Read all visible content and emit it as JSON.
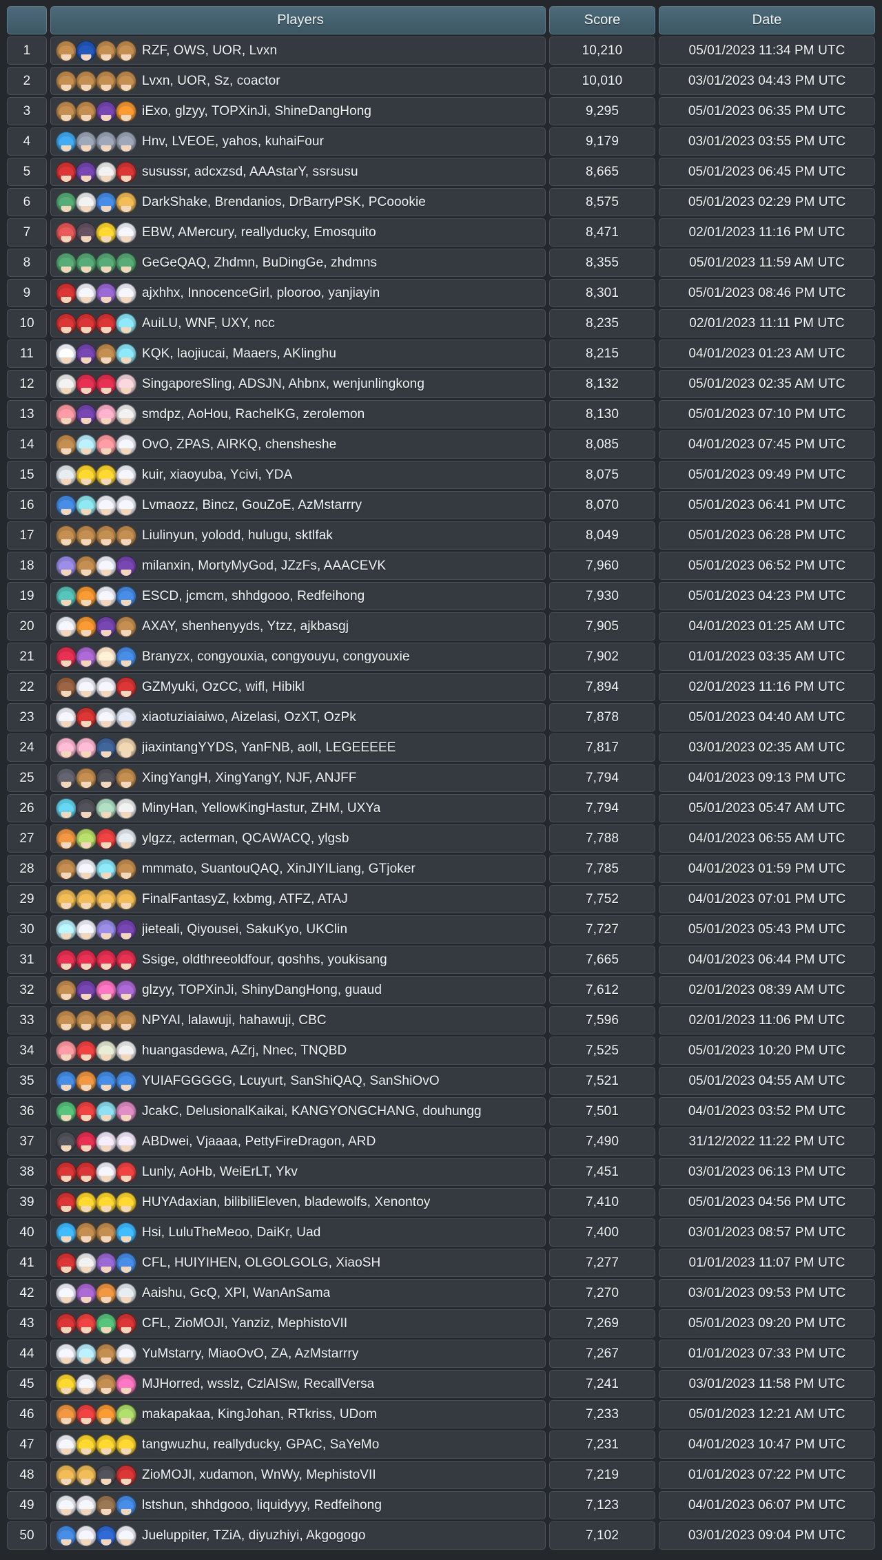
{
  "table": {
    "columns": [
      {
        "key": "rank",
        "label": ""
      },
      {
        "key": "players",
        "label": "Players"
      },
      {
        "key": "score",
        "label": "Score"
      },
      {
        "key": "date",
        "label": "Date"
      }
    ],
    "header_bg": "#44616f",
    "cell_bg": "#343a40",
    "page_bg": "#24272b",
    "text_color": "#f2f4f6"
  },
  "rows": [
    {
      "rank": "1",
      "players": "RZF, OWS, UOR, Lvxn",
      "score": "10,210",
      "date": "05/01/2023 11:34 PM UTC",
      "avatars": [
        "#b08048",
        "#1f4fa8",
        "#b08048",
        "#b08048"
      ]
    },
    {
      "rank": "2",
      "players": "Lvxn, UOR, Sz, coactor",
      "score": "10,010",
      "date": "03/01/2023 04:43 PM UTC",
      "avatars": [
        "#b08048",
        "#b08048",
        "#b08048",
        "#b08048"
      ]
    },
    {
      "rank": "3",
      "players": "iExo, glzyy, TOPXinJi, ShineDangHong",
      "score": "9,295",
      "date": "05/01/2023 06:35 PM UTC",
      "avatars": [
        "#b08048",
        "#b08048",
        "#6b3fa0",
        "#e08a2e"
      ]
    },
    {
      "rank": "4",
      "players": "Hnv, LVEOE, yahos, kuhaiFour",
      "score": "9,179",
      "date": "03/01/2023 03:55 PM UTC",
      "avatars": [
        "#3a9ad9",
        "#8d96a6",
        "#8d96a6",
        "#8d96a6"
      ]
    },
    {
      "rank": "5",
      "players": "susussr, adcxzsd, AAAstarY, ssrsusu",
      "score": "8,665",
      "date": "05/01/2023 06:45 PM UTC",
      "avatars": [
        "#c43030",
        "#6b3fa0",
        "#d8d8d8",
        "#c43030"
      ]
    },
    {
      "rank": "6",
      "players": "DarkShake, Brendanios, DrBarryPSK, PCoookie",
      "score": "8,575",
      "date": "05/01/2023 02:29 PM UTC",
      "avatars": [
        "#4f9a6a",
        "#d8d8d8",
        "#3f7fd0",
        "#d8a94e"
      ]
    },
    {
      "rank": "7",
      "players": "EBW, AMercury, reallyducky, Emosquito",
      "score": "8,471",
      "date": "02/01/2023 11:16 PM UTC",
      "avatars": [
        "#d05050",
        "#5a4a58",
        "#e8c22a",
        "#dcdce4"
      ]
    },
    {
      "rank": "8",
      "players": "GeGeQAQ, Zhdmn, BuDingGe, zhdmns",
      "score": "8,355",
      "date": "05/01/2023 11:59 AM UTC",
      "avatars": [
        "#4f9a6a",
        "#4f9a6a",
        "#4f9a6a",
        "#4f9a6a"
      ]
    },
    {
      "rank": "9",
      "players": "ajxhhx, InnocenceGirl, plooroo, yanjiayin",
      "score": "8,301",
      "date": "05/01/2023 08:46 PM UTC",
      "avatars": [
        "#c43030",
        "#dcdce4",
        "#8b5fc0",
        "#dcdce4"
      ]
    },
    {
      "rank": "10",
      "players": "AuiLU, WNF, UXY, ncc",
      "score": "8,235",
      "date": "02/01/2023 11:11 PM UTC",
      "avatars": [
        "#c43030",
        "#c43030",
        "#c43030",
        "#7fd0e0"
      ]
    },
    {
      "rank": "11",
      "players": "KQK, laojiucai, Maaers, AKlinghu",
      "score": "8,215",
      "date": "04/01/2023 01:23 AM UTC",
      "avatars": [
        "#e4e4ec",
        "#6b3fa0",
        "#b08048",
        "#7fd0e0"
      ]
    },
    {
      "rank": "12",
      "players": "SingaporeSling, ADSJN, Ahbnx, wenjunlingkong",
      "score": "8,132",
      "date": "05/01/2023 02:35 AM UTC",
      "avatars": [
        "#d8d8d8",
        "#d02c4a",
        "#d02c4a",
        "#e0c0c8"
      ]
    },
    {
      "rank": "13",
      "players": "smdpz, AoHou, RachelKG, zerolemon",
      "score": "8,130",
      "date": "05/01/2023 07:10 PM UTC",
      "avatars": [
        "#e88c94",
        "#6b3fa0",
        "#e8a0b8",
        "#d8d8d8"
      ]
    },
    {
      "rank": "14",
      "players": "OvO, ZPAS, AIRKQ, chensheshe",
      "score": "8,085",
      "date": "04/01/2023 07:45 PM UTC",
      "avatars": [
        "#b08048",
        "#a8d8e8",
        "#e88c94",
        "#dcdce4"
      ]
    },
    {
      "rank": "15",
      "players": "kuir, xiaoyuba, Ycivi, YDA",
      "score": "8,075",
      "date": "05/01/2023 09:49 PM UTC",
      "avatars": [
        "#cfd4d8",
        "#e8c22a",
        "#e8c22a",
        "#dcdce4"
      ]
    },
    {
      "rank": "16",
      "players": "Lvmaozz, Bincz, GouZoE, AzMstarrry",
      "score": "8,070",
      "date": "05/01/2023 06:41 PM UTC",
      "avatars": [
        "#3f7fd0",
        "#7fd0d8",
        "#dcdce4",
        "#dcdce4"
      ]
    },
    {
      "rank": "17",
      "players": "Liulinyun, yolodd, hulugu, sktlfak",
      "score": "8,049",
      "date": "05/01/2023 06:28 PM UTC",
      "avatars": [
        "#b08048",
        "#b08048",
        "#b08048",
        "#b08048"
      ]
    },
    {
      "rank": "18",
      "players": "milanxin, MortyMyGod, JZzFs, AAACEVK",
      "score": "7,960",
      "date": "05/01/2023 06:52 PM UTC",
      "avatars": [
        "#8b7fd0",
        "#b08048",
        "#dcdce4",
        "#6b3fa0"
      ]
    },
    {
      "rank": "19",
      "players": "ESCD, jcmcm, shhdgooo, Redfeihong",
      "score": "7,930",
      "date": "05/01/2023 04:23 PM UTC",
      "avatars": [
        "#4fb0a8",
        "#e08a2e",
        "#dcdce4",
        "#3f7fd0"
      ]
    },
    {
      "rank": "20",
      "players": "AXAY, shenhenyyds, Ytzz, ajkbasgj",
      "score": "7,905",
      "date": "04/01/2023 01:25 AM UTC",
      "avatars": [
        "#dcdce4",
        "#e08a2e",
        "#6b3fa0",
        "#b08048"
      ]
    },
    {
      "rank": "21",
      "players": "Branyzx, congyouxia, congyouyu, congyouxie",
      "score": "7,902",
      "date": "01/01/2023 03:35 AM UTC",
      "avatars": [
        "#d02c4a",
        "#9b5fc0",
        "#f0d8c0",
        "#3f7fd0"
      ]
    },
    {
      "rank": "22",
      "players": "GZMyuki, OzCC, wifl, Hibikl",
      "score": "7,894",
      "date": "02/01/2023 11:16 PM UTC",
      "avatars": [
        "#8b5a3c",
        "#dcdce4",
        "#dcdce4",
        "#c43030"
      ]
    },
    {
      "rank": "23",
      "players": "xiaotuziaiaiwo, Aizelasi, OzXT, OzPk",
      "score": "7,878",
      "date": "05/01/2023 04:40 AM UTC",
      "avatars": [
        "#dcdce4",
        "#c43030",
        "#dcdce4",
        "#cfd4e0"
      ]
    },
    {
      "rank": "24",
      "players": "jiaxintangYYDS, YanFNB, aoll, LEGEEEEE",
      "score": "7,817",
      "date": "03/01/2023 02:35 AM UTC",
      "avatars": [
        "#e8a8c0",
        "#e8a8c0",
        "#3a5a8c",
        "#d8c0a0"
      ]
    },
    {
      "rank": "25",
      "players": "XingYangH, XingYangY, NJF, ANJFF",
      "score": "7,794",
      "date": "04/01/2023 09:13 PM UTC",
      "avatars": [
        "#5a5a66",
        "#b08048",
        "#4a4a52",
        "#b08048"
      ]
    },
    {
      "rank": "26",
      "players": "MinyHan, YellowKingHastur, ZHM, UXYa",
      "score": "7,794",
      "date": "05/01/2023 05:47 AM UTC",
      "avatars": [
        "#5ac0d8",
        "#4a4a52",
        "#9ec8b0",
        "#d8d8d8"
      ]
    },
    {
      "rank": "27",
      "players": "ylgzz, acterman, QCAWACQ, ylgsb",
      "score": "7,788",
      "date": "04/01/2023 06:55 AM UTC",
      "avatars": [
        "#d8883c",
        "#a8c860",
        "#d83c3c",
        "#cfd4d8"
      ]
    },
    {
      "rank": "28",
      "players": "mmmato, SuantouQAQ, XinJIYILiang, GTjoker",
      "score": "7,785",
      "date": "04/01/2023 01:59 PM UTC",
      "avatars": [
        "#b08048",
        "#dcdce4",
        "#7fd0e0",
        "#b08048"
      ]
    },
    {
      "rank": "29",
      "players": "FinalFantasyZ, kxbmg, ATFZ, ATAJ",
      "score": "7,752",
      "date": "04/01/2023 07:01 PM UTC",
      "avatars": [
        "#d8a94e",
        "#d8a94e",
        "#d8a94e",
        "#d8a94e"
      ]
    },
    {
      "rank": "30",
      "players": "jieteali, Qiyousei, SakuKyo, UKClin",
      "score": "7,727",
      "date": "05/01/2023 05:43 PM UTC",
      "avatars": [
        "#a8dce8",
        "#dcdce4",
        "#8b7fd0",
        "#6b3fa0"
      ]
    },
    {
      "rank": "31",
      "players": "Ssige, oldthreeoldfour, qoshhs, youkisang",
      "score": "7,665",
      "date": "04/01/2023 06:44 PM UTC",
      "avatars": [
        "#d02c4a",
        "#d02c4a",
        "#d02c4a",
        "#d02c4a"
      ]
    },
    {
      "rank": "32",
      "players": "glzyy, TOPXinJi, ShinyDangHong, guaud",
      "score": "7,612",
      "date": "02/01/2023 08:39 AM UTC",
      "avatars": [
        "#b08048",
        "#6b3fa0",
        "#e86ab0",
        "#9b5fc0"
      ]
    },
    {
      "rank": "33",
      "players": "NPYAI, lalawuji, hahawuji, CBC",
      "score": "7,596",
      "date": "02/01/2023 11:06 PM UTC",
      "avatars": [
        "#b08048",
        "#b08048",
        "#b08048",
        "#b08048"
      ]
    },
    {
      "rank": "34",
      "players": "huangasdewa, AZrj, Nnec, TNQBD",
      "score": "7,525",
      "date": "05/01/2023 10:20 PM UTC",
      "avatars": [
        "#e88c94",
        "#d83c3c",
        "#cfd4c0",
        "#d8d8d8"
      ]
    },
    {
      "rank": "35",
      "players": "YUIAFGGGGG, Lcuyurt, SanShiQAQ, SanShiOvO",
      "score": "7,521",
      "date": "05/01/2023 04:55 AM UTC",
      "avatars": [
        "#3f7fd0",
        "#d8883c",
        "#3f7fd0",
        "#3f7fd0"
      ]
    },
    {
      "rank": "36",
      "players": "JcakC, DelusionalKaikai, KANGYONGCHANG, douhungg",
      "score": "7,501",
      "date": "04/01/2023 03:52 PM UTC",
      "avatars": [
        "#4fb070",
        "#d83c3c",
        "#7fc8d8",
        "#c87fb0"
      ]
    },
    {
      "rank": "37",
      "players": "ABDwei, Vjaaaa, PettyFireDragon, ARD",
      "score": "7,490",
      "date": "31/12/2022 11:22 PM UTC",
      "avatars": [
        "#4a4a52",
        "#d02c4a",
        "#dcd4e4",
        "#dcd4e4"
      ]
    },
    {
      "rank": "38",
      "players": "Lunly, AoHb, WeiErLT, Ykv",
      "score": "7,451",
      "date": "03/01/2023 06:13 PM UTC",
      "avatars": [
        "#c43030",
        "#c43030",
        "#dcdce4",
        "#d83c3c"
      ]
    },
    {
      "rank": "39",
      "players": "HUYAdaxian, bilibiliEleven, bladewolfs, Xenontoy",
      "score": "7,410",
      "date": "05/01/2023 04:56 PM UTC",
      "avatars": [
        "#c43030",
        "#e8c22a",
        "#e8c22a",
        "#e8c22a"
      ]
    },
    {
      "rank": "40",
      "players": "Hsi, LuluTheMeoo, DaiKr, Uad",
      "score": "7,400",
      "date": "03/01/2023 08:57 PM UTC",
      "avatars": [
        "#3aa8e8",
        "#b08048",
        "#b08048",
        "#3aa8e8"
      ]
    },
    {
      "rank": "41",
      "players": "CFL, HUIYIHEN, OLGOLGOLG, XiaoSH",
      "score": "7,277",
      "date": "01/01/2023 11:07 PM UTC",
      "avatars": [
        "#c43030",
        "#d8d8d8",
        "#8b5fc0",
        "#3f7fd0"
      ]
    },
    {
      "rank": "42",
      "players": "Aaishu, GcQ, XPI, WanAnSama",
      "score": "7,270",
      "date": "03/01/2023 09:53 PM UTC",
      "avatars": [
        "#dcdce4",
        "#9b5fc0",
        "#d8883c",
        "#cfd4d8"
      ]
    },
    {
      "rank": "43",
      "players": "CFL, ZioMOJI, Yanziz, MephistoVII",
      "score": "7,269",
      "date": "05/01/2023 09:20 PM UTC",
      "avatars": [
        "#c43030",
        "#d83c3c",
        "#4fb070",
        "#c43030"
      ]
    },
    {
      "rank": "44",
      "players": "YuMstarry, MiaoOvO, ZA, AzMstarrry",
      "score": "7,267",
      "date": "01/01/2023 07:33 PM UTC",
      "avatars": [
        "#dcdce4",
        "#a8d8e8",
        "#b08048",
        "#dcdce4"
      ]
    },
    {
      "rank": "45",
      "players": "MJHorred, wsslz, CzlAISw, RecallVersa",
      "score": "7,241",
      "date": "03/01/2023 11:58 PM UTC",
      "avatars": [
        "#e8c22a",
        "#dcdce4",
        "#b08048",
        "#e86ab0"
      ]
    },
    {
      "rank": "46",
      "players": "makapakaa, KingJohan, RTkriss, UDom",
      "score": "7,233",
      "date": "05/01/2023 12:21 AM UTC",
      "avatars": [
        "#d8883c",
        "#d83c3c",
        "#e08a2e",
        "#9ec860"
      ]
    },
    {
      "rank": "47",
      "players": "tangwuzhu, reallyducky, GPAC, SaYeMo",
      "score": "7,231",
      "date": "04/01/2023 10:47 PM UTC",
      "avatars": [
        "#dcdce4",
        "#e8c22a",
        "#e8c22a",
        "#e8c22a"
      ]
    },
    {
      "rank": "48",
      "players": "ZioMOJI, xudamon, WnWy, MephistoVII",
      "score": "7,219",
      "date": "01/01/2023 07:22 PM UTC",
      "avatars": [
        "#d8a94e",
        "#d8a94e",
        "#4a4a52",
        "#c43030"
      ]
    },
    {
      "rank": "49",
      "players": "lstshun, shhdgooo, liquidyyy, Redfeihong",
      "score": "7,123",
      "date": "04/01/2023 06:07 PM UTC",
      "avatars": [
        "#dcdce4",
        "#dcdce4",
        "#8b6a4a",
        "#3f7fd0"
      ]
    },
    {
      "rank": "50",
      "players": "Jueluppiter, TZiA, diyuzhiyi, Akgogogo",
      "score": "7,102",
      "date": "03/01/2023 09:04 PM UTC",
      "avatars": [
        "#3f7fd0",
        "#dcdce4",
        "#2a5fc0",
        "#dcdce4"
      ]
    }
  ]
}
